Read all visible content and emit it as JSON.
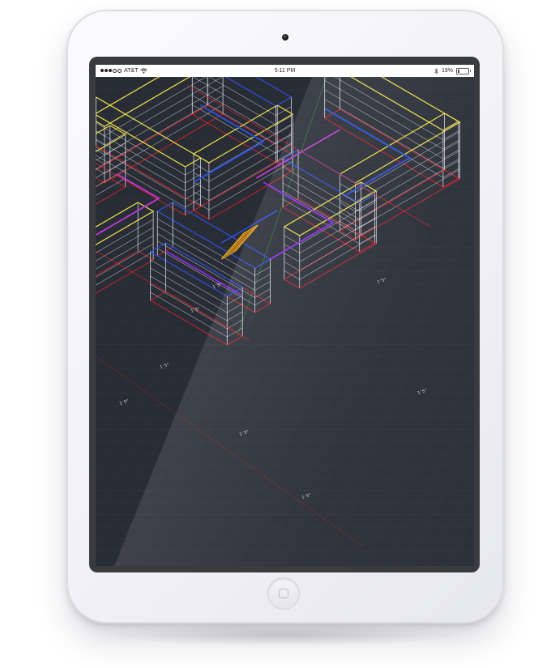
{
  "status_bar": {
    "carrier": "AT&T",
    "time": "5:11 PM",
    "battery": "19%",
    "battery_level": 0.19,
    "signal_bars": 3,
    "icons": [
      "signal-dots-icon",
      "wifi-icon",
      "bluetooth-icon",
      "battery-icon"
    ]
  },
  "drawing": {
    "background": "#282c35",
    "grid_color": "#3a4150",
    "line_colors": {
      "yellow": "#e6d94a",
      "blue": "#2a4fd6",
      "purple": "#8a2be2",
      "magenta": "#c23ad8",
      "red": "#d8222a",
      "white": "#d8d8e0",
      "orange": "#f0a018"
    },
    "dimension_labels": [
      "1'5\"",
      "1'5\"",
      "1'5\"",
      "1'5\"",
      "1'5\"",
      "1'5\"",
      "1'5\"",
      "1'5\""
    ]
  }
}
